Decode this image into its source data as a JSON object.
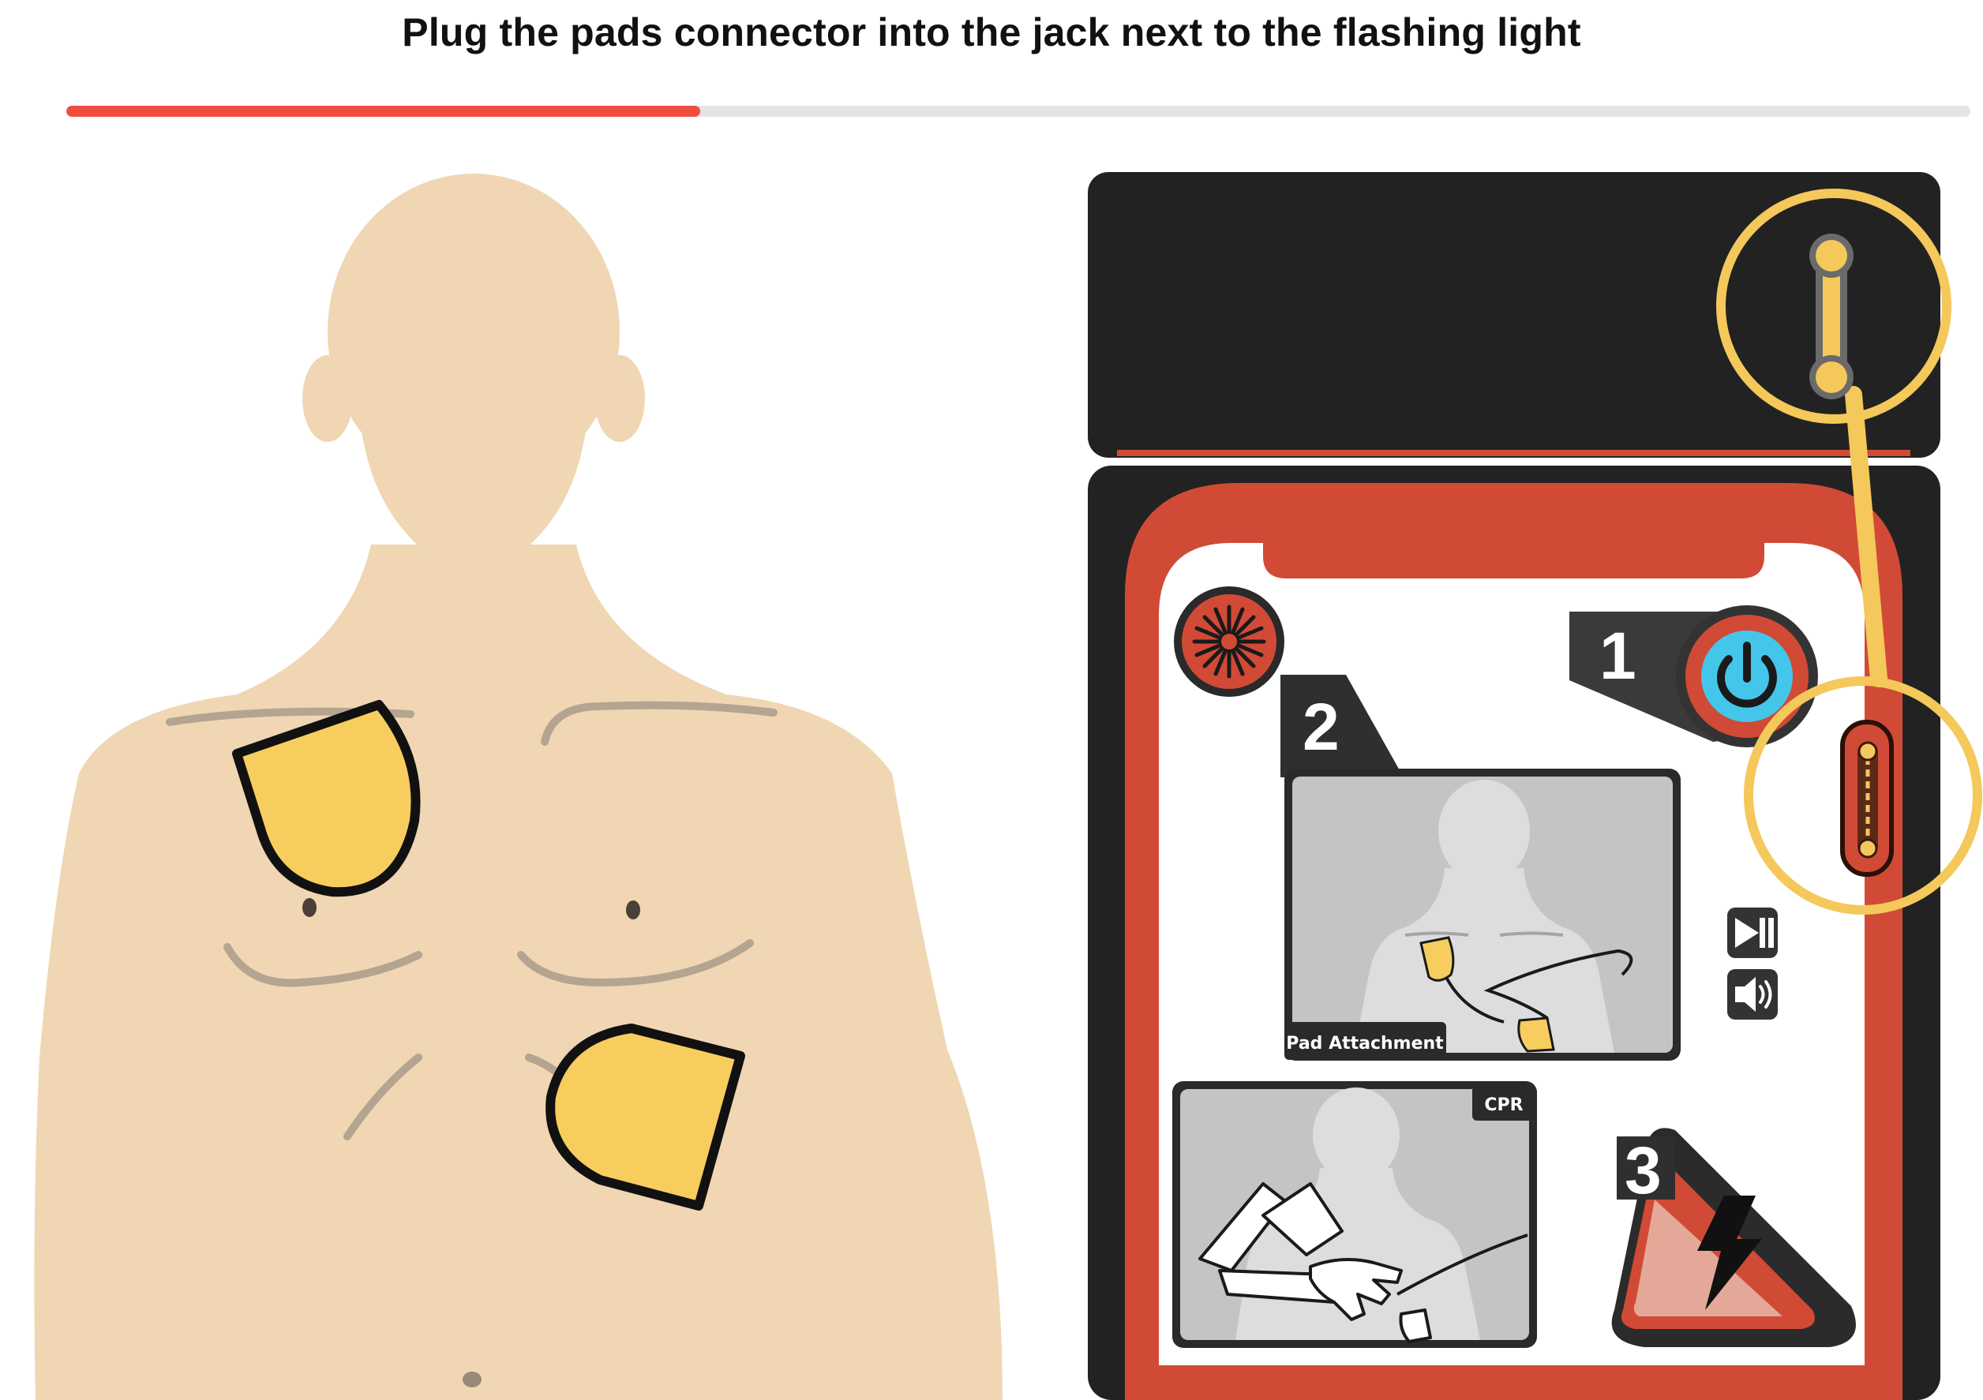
{
  "instruction": "Plug the pads connector into the jack next to the flashing light",
  "progress": {
    "fraction": 0.333,
    "fill_color": "#ef4d3f",
    "track_color": "#e4e4e4"
  },
  "colors": {
    "skin": "#f0d6b3",
    "pad": "#f7cd5e",
    "device_body": "#222222",
    "device_red": "#d14a36",
    "highlight": "#f4c85a",
    "power_blue": "#44c6ea"
  },
  "device": {
    "step1_number": "1",
    "step2_number": "2",
    "step3_number": "3",
    "pad_attachment_label": "Pad Attachment",
    "cpr_label": "CPR"
  },
  "icons": {
    "speaker": "speaker-grille-icon",
    "power": "power-icon",
    "play_pause": "play-pause-icon",
    "volume": "volume-icon",
    "shock": "lightning-bolt-icon"
  }
}
